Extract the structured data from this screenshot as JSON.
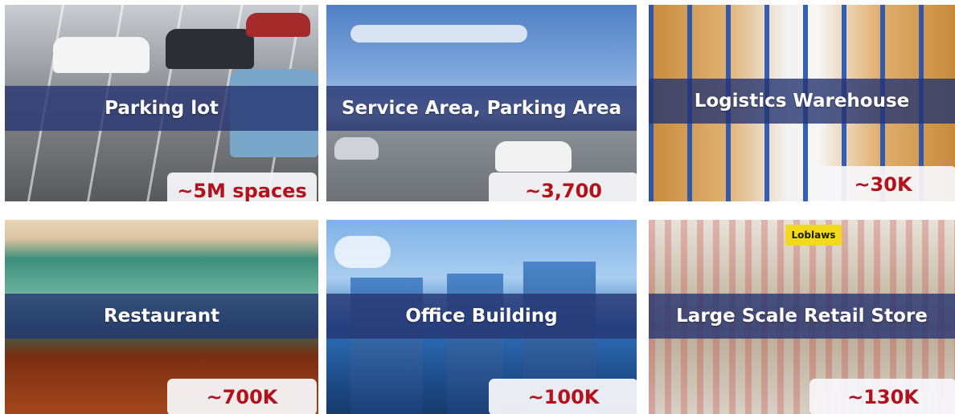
{
  "tiles": [
    {
      "label": "Parking lot",
      "value": "~5M spaces"
    },
    {
      "label": "Service Area, Parking Area",
      "value": "~3,700"
    },
    {
      "label": "Logistics Warehouse",
      "value": "~30K"
    },
    {
      "label": "Restaurant",
      "value": "~700K"
    },
    {
      "label": "Office Building",
      "value": "~100K"
    },
    {
      "label": "Large Scale Retail Store",
      "value": "~130K"
    }
  ],
  "colors": {
    "label_band": "#263470",
    "value_text": "#b3111b",
    "value_box": "#f6f6fa"
  },
  "photo_signage": {
    "store_brand": "Loblaws"
  }
}
